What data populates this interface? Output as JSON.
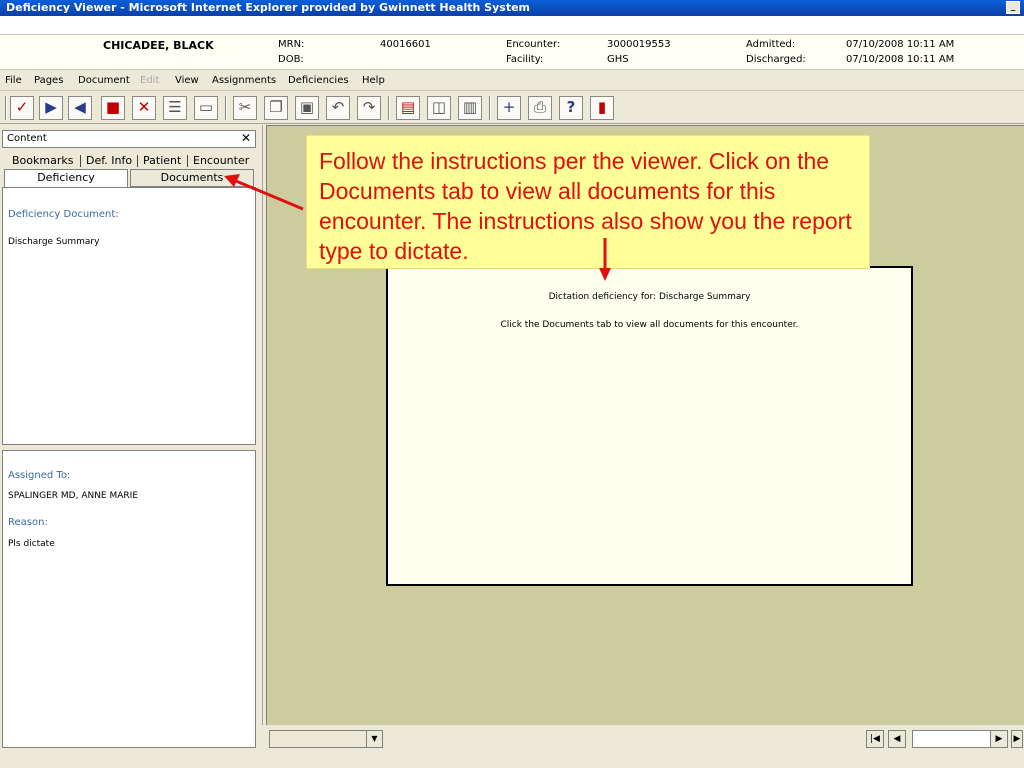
{
  "window": {
    "title": "Deficiency Viewer - Microsoft Internet Explorer provided by Gwinnett Health System"
  },
  "patient": {
    "name": "CHICADEE, BLACK",
    "mrn_label": "MRN:",
    "mrn": "40016601",
    "dob_label": "DOB:",
    "encounter_label": "Encounter:",
    "encounter": "3000019553",
    "facility_label": "Facility:",
    "facility": "GHS",
    "admitted_label": "Admitted:",
    "admitted": "07/10/2008 10:11 AM",
    "discharged_label": "Discharged:",
    "discharged": "07/10/2008 10:11 AM"
  },
  "menu": [
    "File",
    "Pages",
    "Document",
    "Edit",
    "View",
    "Assignments",
    "Deficiencies",
    "Help"
  ],
  "toolbar_icons": [
    "check-icon",
    "next-icon",
    "prev-icon",
    "bookmark-icon",
    "delete-icon",
    "note-icon",
    "note2-icon",
    "cut-icon",
    "copy-icon",
    "paste-icon",
    "undo-icon",
    "redo-icon",
    "single-page-icon",
    "split-view-icon",
    "two-page-icon",
    "add-icon",
    "print-icon",
    "help-icon",
    "exit-icon"
  ],
  "left_panel": {
    "header": "Content",
    "close": "✕",
    "tabs_row1": [
      "Bookmarks",
      "Def. Info",
      "Patient",
      "Encounter"
    ],
    "tab_active": "Deficiency",
    "tab_documents": "Documents",
    "deficiency_document_label": "Deficiency Document:",
    "deficiency_document": "Discharge Summary",
    "assigned_to_label": "Assigned To:",
    "assigned_to": "SPALINGER MD, ANNE MARIE",
    "reason_label": "Reason:",
    "reason": "Pls dictate"
  },
  "document": {
    "line1": "Dictation deficiency for: Discharge Summary",
    "line2": "Click the Documents tab to view all documents for this encounter."
  },
  "callout": {
    "text": "Follow the instructions per the viewer. Click on the Documents tab to view all documents for this encounter. The instructions also show you the report type to dictate."
  },
  "colors": {
    "callout_bg": "#ffff99",
    "callout_text": "#e01010",
    "viewer_bg": "#cccc9f",
    "arrow": "#e01010"
  }
}
